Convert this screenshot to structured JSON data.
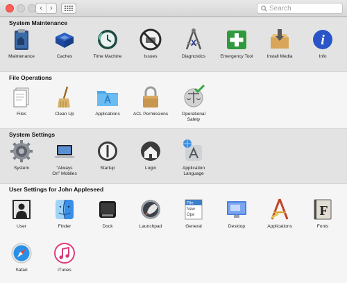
{
  "window": {
    "nav": {
      "back": "‹",
      "forward": "›"
    },
    "search": {
      "placeholder": "Search"
    }
  },
  "sections": [
    {
      "title": "System Maintenance",
      "items": [
        {
          "label": "Maintenance",
          "icon": "clipboard-icon"
        },
        {
          "label": "Caches",
          "icon": "bin-icon"
        },
        {
          "label": "Time Machine",
          "icon": "time-machine-icon"
        },
        {
          "label": "Issues",
          "icon": "no-symbol-icon"
        },
        {
          "label": "Diagnostics",
          "icon": "compass-icon"
        },
        {
          "label": "Emergency Tool",
          "icon": "first-aid-icon"
        },
        {
          "label": "Install Media",
          "icon": "installer-box-icon"
        },
        {
          "label": "Info",
          "icon": "info-icon"
        }
      ]
    },
    {
      "title": "File Operations",
      "items": [
        {
          "label": "Files",
          "icon": "files-icon"
        },
        {
          "label": "Clean Up",
          "icon": "broom-icon"
        },
        {
          "label": "Applications",
          "icon": "applications-folder-icon"
        },
        {
          "label": "ACL Permissions",
          "icon": "padlock-icon"
        },
        {
          "label": "Operational\nSafety",
          "icon": "scales-check-icon"
        }
      ]
    },
    {
      "title": "System Settings",
      "items": [
        {
          "label": "System",
          "icon": "gear-icon"
        },
        {
          "label": "“Always\nOn” Mobiles",
          "icon": "laptop-icon"
        },
        {
          "label": "Startup",
          "icon": "power-icon"
        },
        {
          "label": "Login",
          "icon": "house-icon"
        },
        {
          "label": "Application\nLanguage",
          "icon": "app-store-globe-icon"
        }
      ]
    },
    {
      "title": "User Settings for John Appleseed",
      "items": [
        {
          "label": "User",
          "icon": "user-silhouette-icon"
        },
        {
          "label": "Finder",
          "icon": "finder-icon"
        },
        {
          "label": "Dock",
          "icon": "dock-icon"
        },
        {
          "label": "Launchpad",
          "icon": "rocket-icon"
        },
        {
          "label": "General",
          "icon": "file-new-icon",
          "icon_text": [
            "File",
            "New",
            "Ope"
          ]
        },
        {
          "label": "Desktop",
          "icon": "desktop-icon"
        },
        {
          "label": "Applications",
          "icon": "drafting-tools-icon"
        },
        {
          "label": "Fonts",
          "icon": "font-book-icon",
          "icon_text": [
            "F"
          ]
        },
        {
          "label": "Safari",
          "icon": "safari-compass-icon"
        },
        {
          "label": "iTunes",
          "icon": "music-note-icon"
        }
      ]
    }
  ]
}
